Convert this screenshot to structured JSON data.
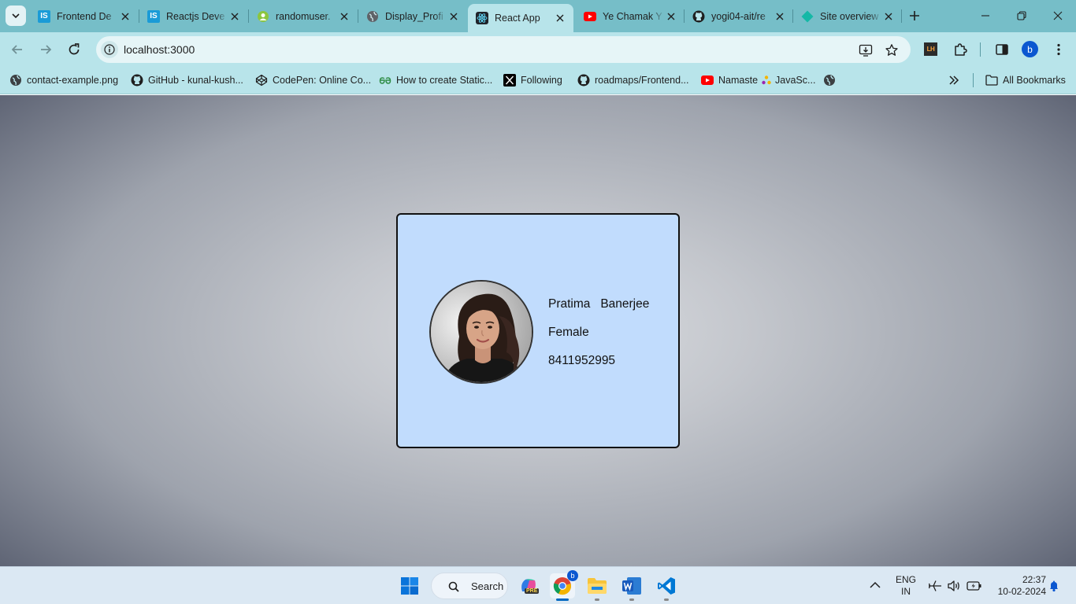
{
  "browser": {
    "tabs": [
      {
        "title": "Frontend De",
        "icon": "is-favicon",
        "active": false
      },
      {
        "title": "Reactjs Deve",
        "icon": "is-favicon",
        "active": false
      },
      {
        "title": "randomuser.",
        "icon": "randomuser-favicon",
        "active": false
      },
      {
        "title": "Display_Profi",
        "icon": "globe-favicon",
        "active": false
      },
      {
        "title": "React App",
        "icon": "react-favicon",
        "active": true
      },
      {
        "title": "Ye Chamak Y",
        "icon": "youtube-favicon",
        "active": false
      },
      {
        "title": "yogi04-ait/re",
        "icon": "github-favicon",
        "active": false
      },
      {
        "title": "Site overview",
        "icon": "netlify-favicon",
        "active": false
      }
    ],
    "tab_favicon_letters": {
      "is": "IS"
    },
    "address_bar": {
      "url": "localhost:3000"
    },
    "profile_initial": "b",
    "lighthouse_label": "LH",
    "bookmarks": [
      {
        "label": "contact-example.png",
        "icon": "globe-icon"
      },
      {
        "label": "GitHub - kunal-kush...",
        "icon": "github-icon"
      },
      {
        "label": "CodePen: Online Co...",
        "icon": "codepen-icon"
      },
      {
        "label": "How to create Static...",
        "icon": "gfg-icon"
      },
      {
        "label": "Following",
        "icon": "x-icon"
      },
      {
        "label": "roadmaps/Frontend...",
        "icon": "github-icon"
      },
      {
        "label": "Namaste",
        "icon": "youtube-icon"
      },
      {
        "label": "JavaSc...",
        "icon": "javascript-emoji-icon"
      }
    ],
    "all_bookmarks_label": "All Bookmarks",
    "accent_color": "#76bec8"
  },
  "profile_card": {
    "first_name": "Pratima",
    "last_name": "Banerjee",
    "full_name_display": "Pratima   Banerjee",
    "gender": "Female",
    "phone": "8411952995",
    "card_color": "#c1dcfd"
  },
  "taskbar": {
    "search_label": "Search",
    "language_line1": "ENG",
    "language_line2": "IN",
    "time": "22:37",
    "date": "10-02-2024",
    "chrome_profile_badge": "b",
    "copilot_badge": "PRE"
  }
}
